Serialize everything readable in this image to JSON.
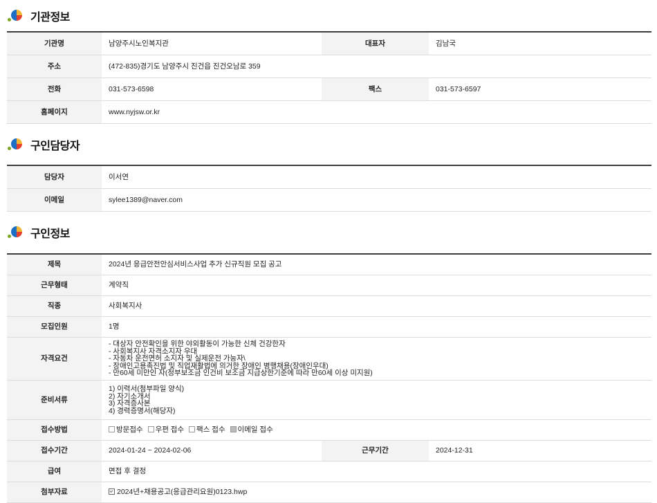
{
  "org_section": {
    "title": "기관정보",
    "rows": [
      {
        "label": "기관명",
        "value": "남양주시노인복지관",
        "label2": "대표자",
        "value2": "김남국"
      },
      {
        "label": "주소",
        "value": "(472-835)경기도 남양주시 진건읍 진건오남로 359"
      },
      {
        "label": "전화",
        "value": "031-573-6598",
        "label2": "팩스",
        "value2": "031-573-6597"
      },
      {
        "label": "홈페이지",
        "value": "www.nyjsw.or.kr"
      }
    ]
  },
  "contact_section": {
    "title": "구인담당자",
    "rows": [
      {
        "label": "담당자",
        "value": "이서연"
      },
      {
        "label": "이메일",
        "value": "sylee1389@naver.com"
      }
    ]
  },
  "job_section": {
    "title": "구인정보",
    "subject_label": "제목",
    "subject": "2024년 응급안전안심서비스사업 추가 신규직원 모집 공고",
    "worktype_label": "근무형태",
    "worktype": "계약직",
    "jobkind_label": "직종",
    "jobkind": "사회복지사",
    "headcount_label": "모집인원",
    "headcount": "1명",
    "qualification_label": "자격요건",
    "qualifications": [
      "- 대상자 안전확인을 위한 야외활동이 가능한 신체 건강한자",
      "- 사회복지사 자격소지자 우대",
      "- 자동차 운전면허 소지자 및 실제운전 가능자\\",
      "- 장애인고용촉진법 및 직업재활법에 의거한 장애인 병행채용(장애인우대)",
      "- 만60세 미만인 자(정부보조금 인건비 보조금 지급상한기준에 따라 만60세 이상 미지원)"
    ],
    "documents_label": "준비서류",
    "documents": [
      "1) 이력서(첨부파일 양식)",
      "2) 자기소개서",
      "3) 자격증사본",
      "4) 경력증명서(해당자)"
    ],
    "method_label": "접수방법",
    "methods": [
      {
        "label": "방문접수",
        "checked": false
      },
      {
        "label": "우편 접수",
        "checked": false
      },
      {
        "label": "팩스 접수",
        "checked": false
      },
      {
        "label": "이메일 접수",
        "checked": true
      }
    ],
    "period_label": "접수기간",
    "period": "2024-01-24 ~ 2024-02-06",
    "workperiod_label": "근무기간",
    "workperiod": "2024-12-31",
    "salary_label": "급여",
    "salary": "면접 후 결정",
    "attachment_label": "첨부자료",
    "attachment": "2024년+채용공고(응급관리요원)0123.hwp"
  }
}
